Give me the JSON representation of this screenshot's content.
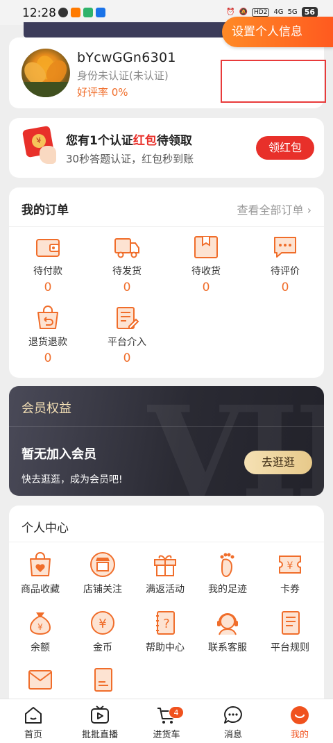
{
  "status_bar": {
    "time": "12:28",
    "battery": "56",
    "hd": "HD2",
    "net_4g": "4G",
    "net_5g": "5G"
  },
  "profile": {
    "username": "bYcwGGn6301",
    "identity_status": "身份未认证(未认证)",
    "rating": "好评率 0%",
    "settings_button": "设置个人信息"
  },
  "red_packet": {
    "title_prefix": "您有1个认证",
    "title_highlight": "红包",
    "title_suffix": "待领取",
    "subtitle": "30秒答题认证，红包秒到账",
    "button": "领红包"
  },
  "orders": {
    "title": "我的订单",
    "view_all": "查看全部订单",
    "items": [
      {
        "label": "待付款",
        "count": "0",
        "icon": "wallet-icon"
      },
      {
        "label": "待发货",
        "count": "0",
        "icon": "truck-icon"
      },
      {
        "label": "待收货",
        "count": "0",
        "icon": "package-icon"
      },
      {
        "label": "待评价",
        "count": "0",
        "icon": "comment-icon"
      },
      {
        "label": "退货退款",
        "count": "0",
        "icon": "return-bag-icon"
      },
      {
        "label": "平台介入",
        "count": "0",
        "icon": "document-pen-icon"
      }
    ]
  },
  "vip": {
    "title": "会员权益",
    "status": "暂无加入会员",
    "subtitle": "快去逛逛，成为会员吧!",
    "button": "去逛逛"
  },
  "personal_center": {
    "title": "个人中心",
    "items": [
      {
        "label": "商品收藏",
        "icon": "heart-bag-icon"
      },
      {
        "label": "店铺关注",
        "icon": "store-icon"
      },
      {
        "label": "满返活动",
        "icon": "gift-icon"
      },
      {
        "label": "我的足迹",
        "icon": "footprint-icon"
      },
      {
        "label": "卡券",
        "icon": "coupon-icon"
      },
      {
        "label": "余额",
        "icon": "money-bag-icon"
      },
      {
        "label": "金币",
        "icon": "coin-icon"
      },
      {
        "label": "帮助中心",
        "icon": "help-book-icon"
      },
      {
        "label": "联系客服",
        "icon": "customer-service-icon"
      },
      {
        "label": "平台规则",
        "icon": "rules-doc-icon"
      }
    ]
  },
  "tabbar": {
    "items": [
      {
        "label": "首页",
        "icon": "home-icon"
      },
      {
        "label": "批批直播",
        "icon": "live-tv-icon"
      },
      {
        "label": "进货车",
        "icon": "cart-icon"
      },
      {
        "label": "消息",
        "icon": "message-icon"
      },
      {
        "label": "我的",
        "icon": "profile-icon"
      }
    ],
    "cart_badge": "4",
    "active_color": "#f0521e"
  },
  "colors": {
    "accent": "#f06d2a",
    "red": "#e8302a",
    "vip_gold": "#f3dfb5"
  }
}
